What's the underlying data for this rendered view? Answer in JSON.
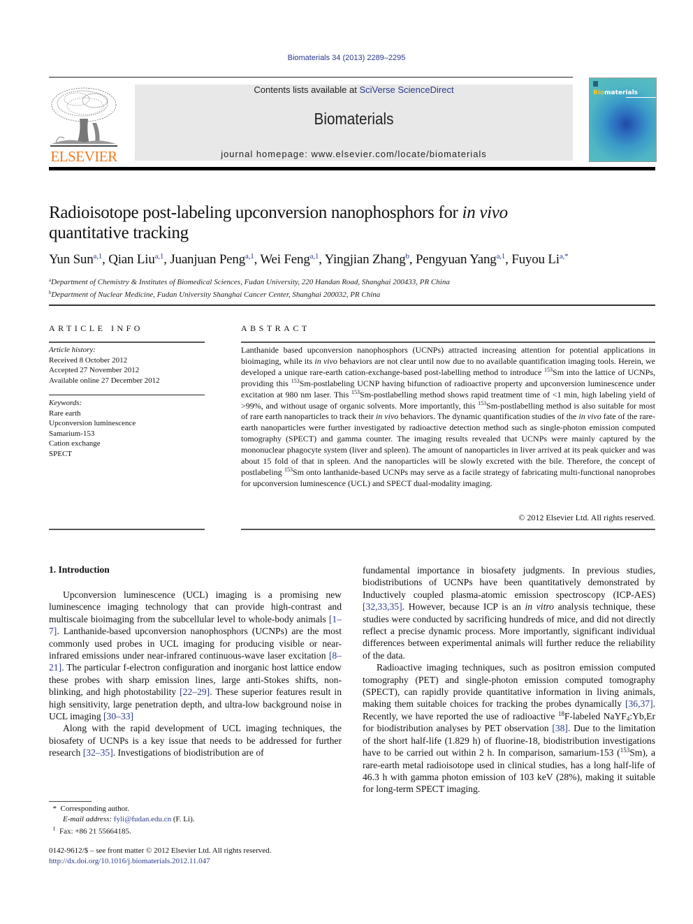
{
  "journal_citation": "Biomaterials 34 (2013) 2289–2295",
  "header": {
    "publisher_logo_text": "ELSEVIER",
    "contents_prefix": "Contents lists available at ",
    "contents_link": "SciVerse ScienceDirect",
    "journal_name": "Biomaterials",
    "homepage_prefix": "journal homepage: ",
    "homepage_url": "www.elsevier.com/locate/biomaterials",
    "cover_title_first": "Bio",
    "cover_title_rest": "materials"
  },
  "article": {
    "title_part1": "Radioisotope post-labeling upconversion nanophosphors for ",
    "title_italic": "in vivo",
    "title_part2": "quantitative tracking",
    "authors": [
      {
        "name": "Yun Sun",
        "marks": "a,1"
      },
      {
        "name": "Qian Liu",
        "marks": "a,1"
      },
      {
        "name": "Juanjuan Peng",
        "marks": "a,1"
      },
      {
        "name": "Wei Feng",
        "marks": "a,1"
      },
      {
        "name": "Yingjian Zhang",
        "marks": "b"
      },
      {
        "name": "Pengyuan Yang",
        "marks": "a,1"
      },
      {
        "name": "Fuyou Li",
        "marks": "a,*"
      }
    ],
    "affiliations": [
      {
        "mark": "a",
        "text": "Department of Chemistry & Institutes of Biomedical Sciences, Fudan University, 220 Handan Road, Shanghai 200433, PR China"
      },
      {
        "mark": "b",
        "text": "Department of Nuclear Medicine, Fudan University Shanghai Cancer Center, Shanghai 200032, PR China"
      }
    ]
  },
  "article_info": {
    "heading": "ARTICLE INFO",
    "history_label": "Article history:",
    "history": [
      "Received 8 October 2012",
      "Accepted 27 November 2012",
      "Available online 27 December 2012"
    ],
    "keywords_label": "Keywords:",
    "keywords": [
      "Rare earth",
      "Upconversion luminescence",
      "Samarium-153",
      "Cation exchange",
      "SPECT"
    ]
  },
  "abstract": {
    "heading": "ABSTRACT",
    "segments": {
      "s1": "Lanthanide based upconversion nanophosphors (UCNPs) attracted increasing attention for potential applications in bioimaging, while its ",
      "i1": "in vivo",
      "s2": " behaviors are not clear until now due to no available quantification imaging tools. Herein, we developed a unique rare-earth cation-exchange-based post-labelling method to introduce ",
      "sup1": "153",
      "s3": "Sm into the lattice of UCNPs, providing this ",
      "sup2": "153",
      "s4": "Sm-postlabeling UCNP having bifunction of radioactive property and upconversion luminescence under excitation at 980 nm laser. This ",
      "sup3": "153",
      "s5": "Sm-postlabelling method shows rapid treatment time of <1 min, high labeling yield of >99%, and without usage of organic solvents. More importantly, this ",
      "sup4": "153",
      "s6": "Sm-postlabelling method is also suitable for most of rare earth nanoparticles to track their ",
      "i2": "in vivo",
      "s7": " behaviors. The dynamic quantification studies of the ",
      "i3": "in vivo",
      "s8": " fate of the rare-earth nanoparticles were further investigated by radioactive detection method such as single-photon emission computed tomography (SPECT) and gamma counter. The imaging results revealed that UCNPs were mainly captured by the mononuclear phagocyte system (liver and spleen). The amount of nanoparticles in liver arrived at its peak quicker and was about 15 fold of that in spleen. And the nanoparticles will be slowly excreted with the bile. Therefore, the concept of postlabeling ",
      "sup5": "153",
      "s9": "Sm onto lanthanide-based UCNPs may serve as a facile strategy of fabricating multi-functional nanoprobes for upconversion luminescence (UCL) and SPECT dual-modality imaging."
    },
    "copyright": "© 2012 Elsevier Ltd. All rights reserved."
  },
  "introduction": {
    "heading": "1.  Introduction",
    "left": {
      "p1a": "Upconversion luminescence (UCL) imaging is a promising new luminescence imaging technology that can provide high-contrast and multiscale bioimaging from the subcellular level to whole-body animals ",
      "r1": "[1–7]",
      "p1b": ". Lanthanide-based upconversion nanophosphors (UCNPs) are the most commonly used probes in UCL imaging for producing visible or near-infrared emissions under near-infrared continuous-wave laser excitation ",
      "r2": "[8–21]",
      "p1c": ". The particular f-electron configuration and inorganic host lattice endow these probes with sharp emission lines, large anti-Stokes shifts, non-blinking, and high photostability ",
      "r3": "[22–29]",
      "p1d": ". These superior features result in high sensitivity, large penetration depth, and ultra-low background noise in UCL imaging ",
      "r4": "[30–33]",
      "p2a": "Along with the rapid development of UCL imaging techniques, the biosafety of UCNPs is a key issue that needs to be addressed for further research ",
      "r5": "[32–35]",
      "p2b": ". Investigations of biodistribution are of"
    },
    "right": {
      "p1a": "fundamental importance in biosafety judgments. In previous studies, biodistributions of UCNPs have been quantitatively demonstrated by Inductively coupled plasma-atomic emission spectroscopy (ICP-AES) ",
      "r1": "[32,33,35]",
      "p1b": ". However, because ICP is an ",
      "i1": "in vitro",
      "p1c": " analysis technique, these studies were conducted by sacrificing hundreds of mice, and did not directly reflect a precise dynamic process. More importantly, significant individual differences between experimental animals will further reduce the reliability of the data.",
      "p2a": "Radioactive imaging techniques, such as positron emission computed tomography (PET) and single-photon emission computed tomography (SPECT), can rapidly provide quantitative information in living animals, making them suitable choices for tracking the probes dynamically ",
      "r2": "[36,37]",
      "p2b": ". Recently, we have reported the use of radioactive ",
      "sup1": "18",
      "p2c": "F-labeled NaYF",
      "sub1": "4",
      "p2d": ":Yb,Er for biodistribution analyses by PET observation ",
      "r3": "[38]",
      "p2e": ". Due to the limitation of the short half-life (1.829 h) of fluorine-18, biodistribution investigations have to be carried out within 2 h. In comparison, samarium-153 (",
      "sup2": "153",
      "p2f": "Sm), a rare-earth metal radioisotope used in clinical studies, has a long half-life of 46.3 h with gamma photon emission of 103 keV (28%), making it suitable for long-term SPECT imaging."
    }
  },
  "footnotes": {
    "corr_mark": "*",
    "corr_text": "Corresponding author.",
    "email_label": "E-mail address: ",
    "email": "fyli@fudan.edu.cn",
    "email_suffix": " (F. Li).",
    "fax_mark": "1",
    "fax_text": "Fax: +86 21 55664185."
  },
  "bottom": {
    "issn_line": "0142-9612/$ – see front matter © 2012 Elsevier Ltd. All rights reserved.",
    "doi": "http://dx.doi.org/10.1016/j.biomaterials.2012.11.047"
  }
}
